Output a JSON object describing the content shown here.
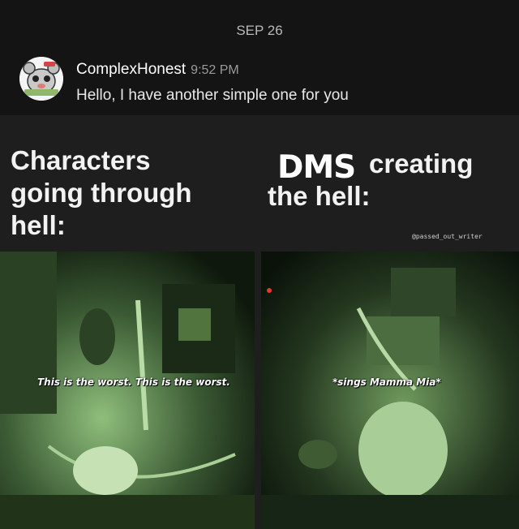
{
  "chat": {
    "date_separator": "SEP 26",
    "message": {
      "username": "ComplexHonest",
      "timestamp": "9:52 PM",
      "text": "Hello, I have another simple one for you"
    }
  },
  "meme": {
    "left_caption": [
      "Characters",
      "going through",
      "hell:"
    ],
    "right_caption_emphasis": "DMS",
    "right_caption_line1": "creating",
    "right_caption_line2": "the hell:",
    "watermark": "@passed_out_writer",
    "left_subtitle": "This is the worst. This is the worst.",
    "right_subtitle": "*sings Mamma Mia*"
  },
  "colors": {
    "background": "#1e1e1f",
    "header_background": "#141414",
    "night_vision_green": "#9fcf8e"
  }
}
